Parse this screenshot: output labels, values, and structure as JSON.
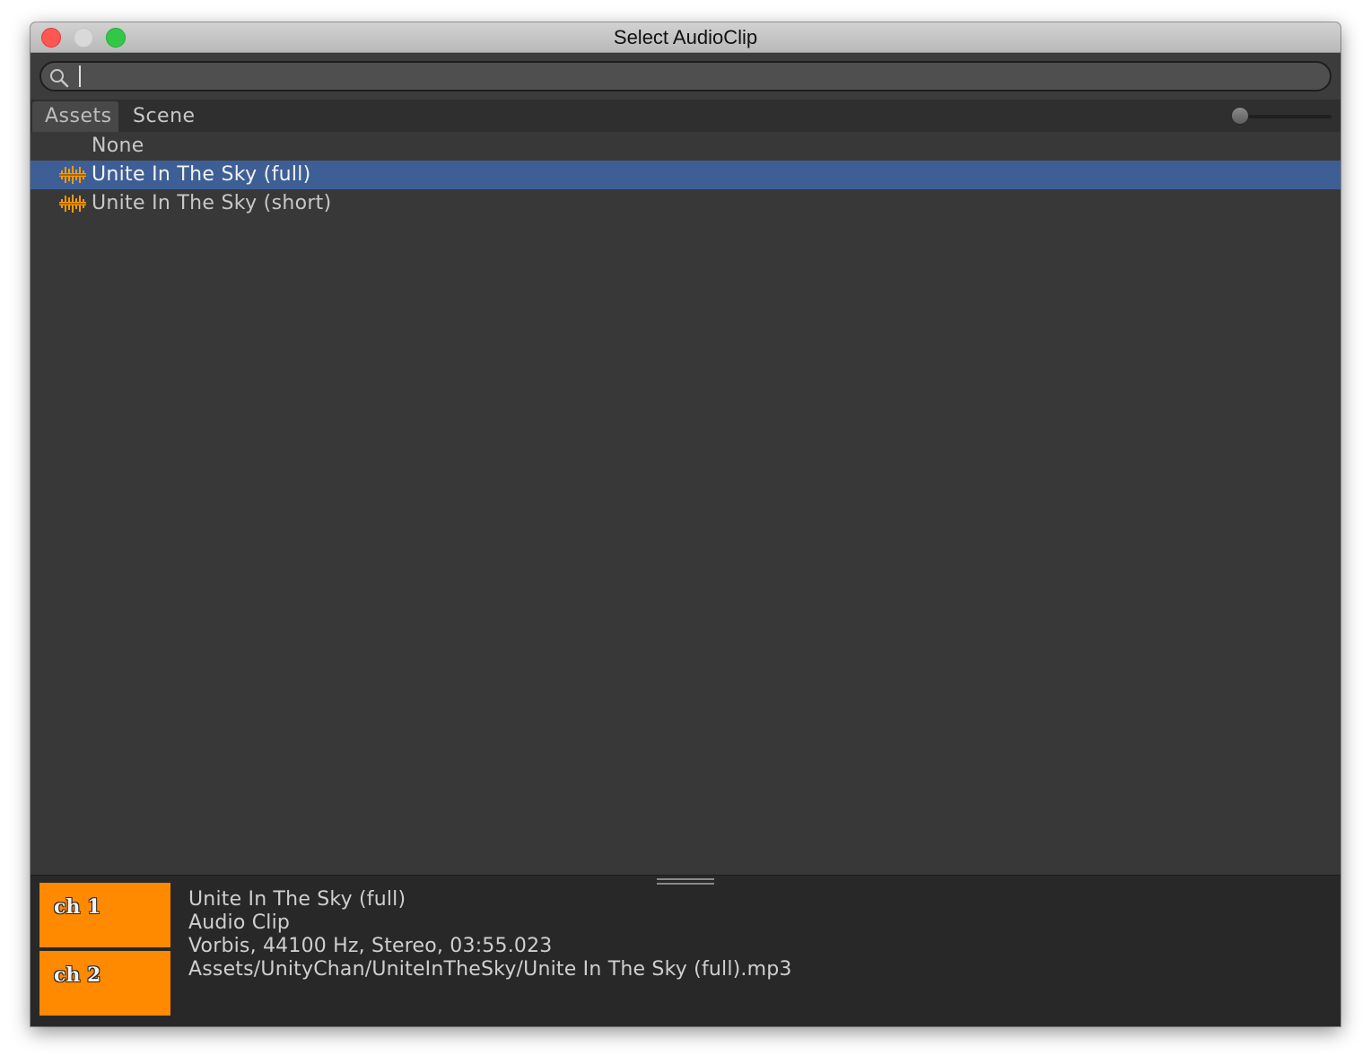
{
  "window": {
    "title": "Select AudioClip"
  },
  "search": {
    "value": "",
    "placeholder": ""
  },
  "tabs": [
    {
      "label": "Assets",
      "active": true
    },
    {
      "label": "Scene",
      "active": false
    }
  ],
  "list": {
    "items": [
      {
        "label": "None",
        "icon": "",
        "selected": false
      },
      {
        "label": "Unite In The Sky (full)",
        "icon": "audio-clip-icon",
        "selected": true
      },
      {
        "label": "Unite In The Sky (short)",
        "icon": "audio-clip-icon",
        "selected": false
      }
    ]
  },
  "preview": {
    "channels": [
      "ch 1",
      "ch 2"
    ],
    "name": "Unite In The Sky (full)",
    "type": "Audio Clip",
    "format": "Vorbis, 44100 Hz, Stereo, 03:55.023",
    "path": "Assets/UnityChan/UniteInTheSky/Unite In The Sky (full).mp3"
  },
  "colors": {
    "selection": "#3e5f96",
    "waveform": "#ff8a00",
    "background": "#383838"
  }
}
